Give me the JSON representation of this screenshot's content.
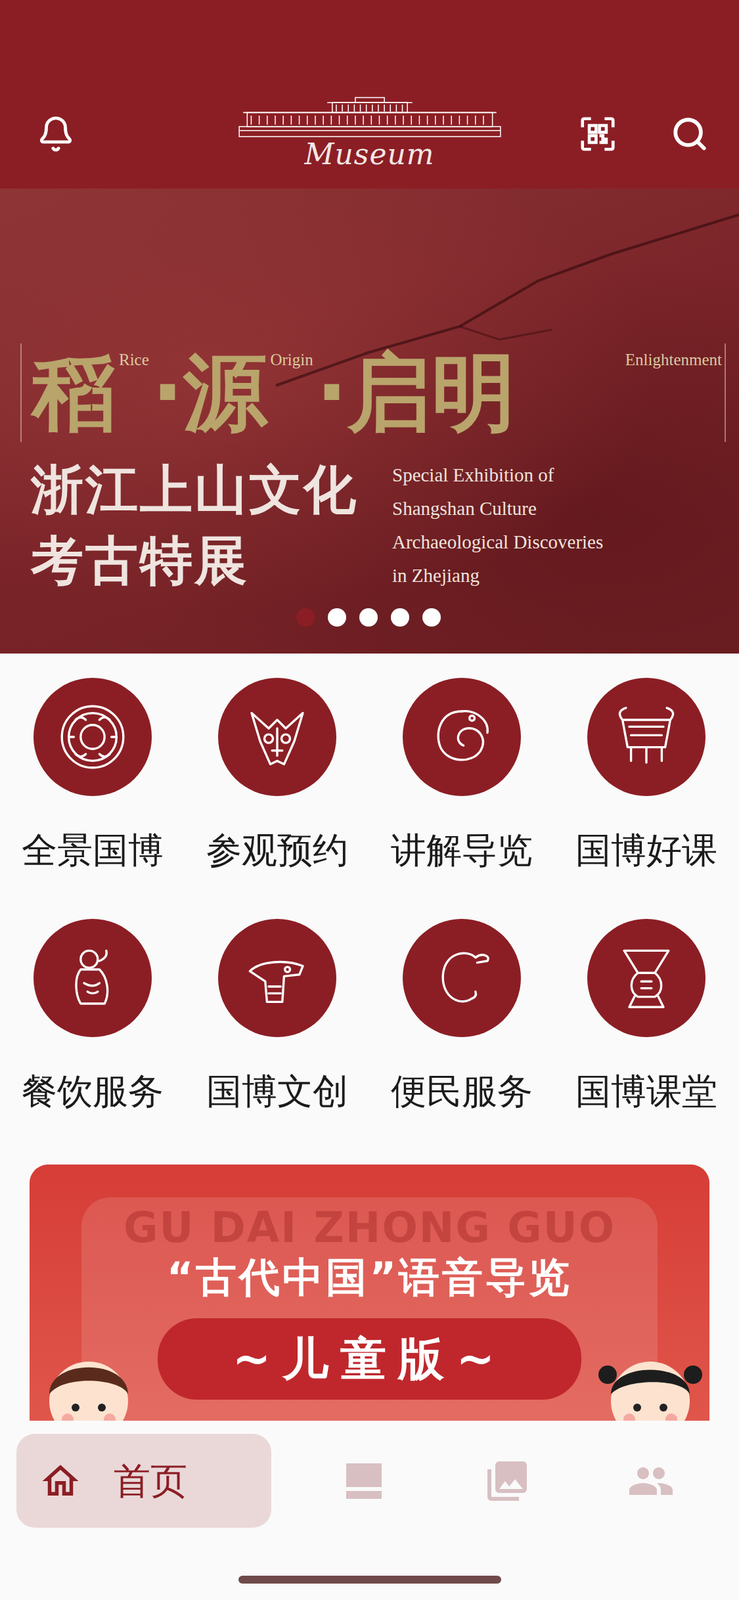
{
  "header": {
    "logo_text": "Museum"
  },
  "banner": {
    "title_parts": [
      {
        "text": "稻",
        "gloss": "Rice"
      },
      {
        "text": "·源",
        "gloss": "Origin"
      },
      {
        "text": "·启明",
        "gloss": "Enlightenment"
      }
    ],
    "subtitle_lines": [
      "浙江上山文化",
      "考古特展"
    ],
    "english_lines": [
      "Special Exhibition of",
      "Shangshan Culture",
      "Archaeological Discoveries",
      "in Zhejiang"
    ],
    "dots": [
      {
        "selected": true
      },
      {
        "selected": false
      },
      {
        "selected": false
      },
      {
        "selected": false
      },
      {
        "selected": false
      }
    ]
  },
  "shortcuts": [
    {
      "label": "全景国博"
    },
    {
      "label": "参观预约"
    },
    {
      "label": "讲解导览"
    },
    {
      "label": "国博好课"
    },
    {
      "label": "餐饮服务"
    },
    {
      "label": "国博文创"
    },
    {
      "label": "便民服务"
    },
    {
      "label": "国博课堂"
    }
  ],
  "promo": {
    "watermark": "GU DAI ZHONG GUO",
    "title": "“古代中国”语音导览",
    "badge": "~儿童版~"
  },
  "nav": [
    {
      "label": "首页",
      "selected": true
    },
    {
      "selected": false
    },
    {
      "selected": false
    },
    {
      "selected": false
    }
  ]
}
